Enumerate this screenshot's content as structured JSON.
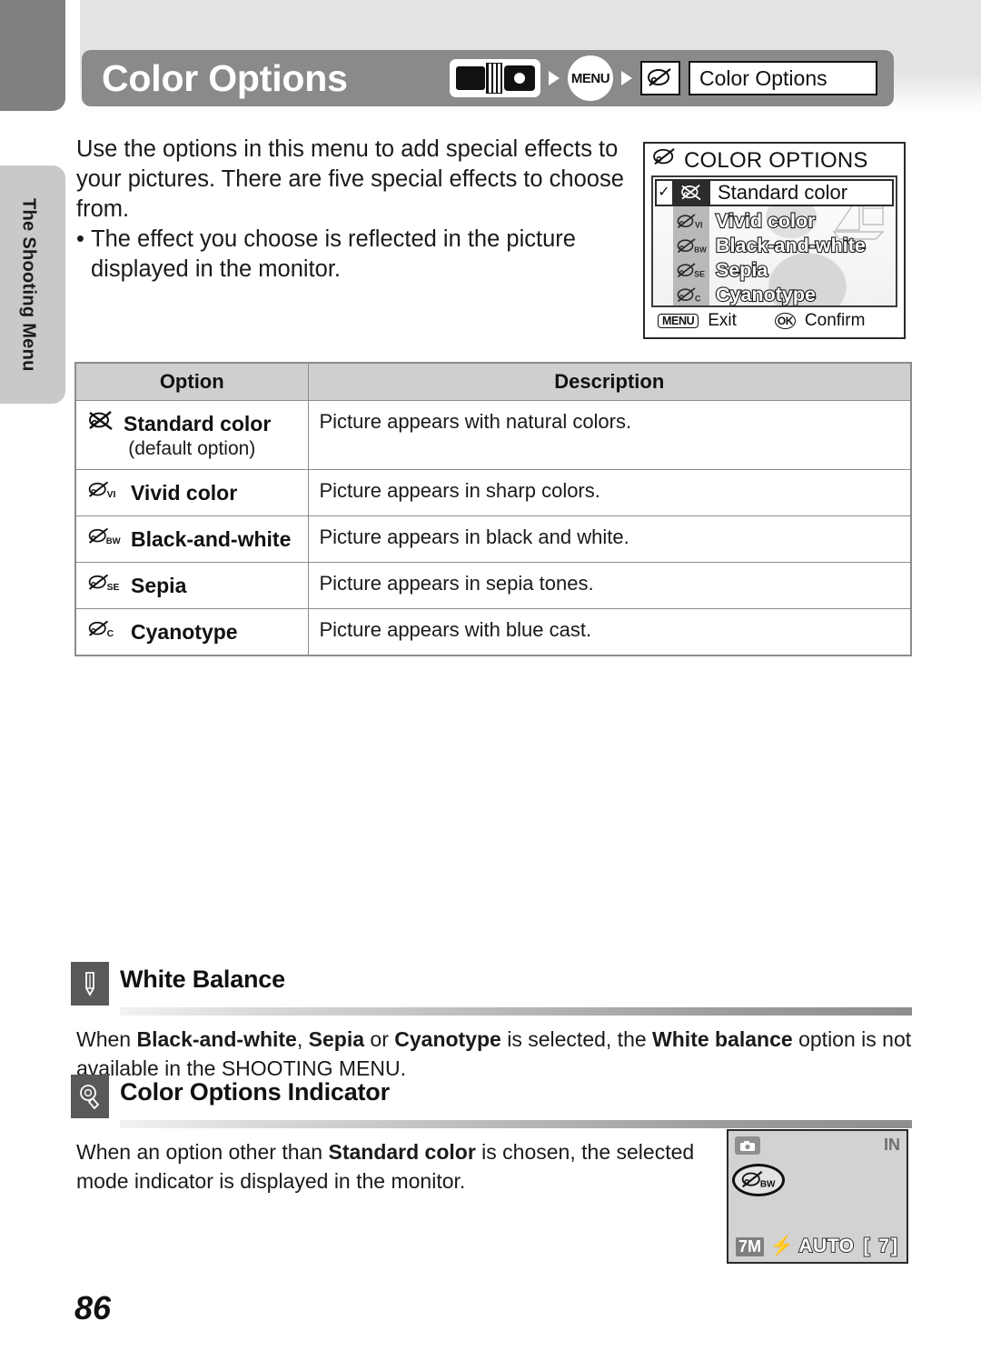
{
  "sidebar": {
    "tab_label": "The Shooting Menu"
  },
  "header": {
    "title": "Color Options",
    "breadcrumb": {
      "mode_icon": "camera-shooting-mode-icon",
      "menu_label": "MENU",
      "palette_icon": "color-options-palette-icon",
      "crumb_label": "Color Options"
    }
  },
  "intro": {
    "paragraph": "Use the options in this menu to add special effects to your pictures. There are five special effects to choose from.",
    "bullet_dot": "•",
    "bullet": "The effect you choose is reflected in the picture displayed in the monitor."
  },
  "lcd": {
    "title": "COLOR OPTIONS",
    "title_icon": "palette-icon",
    "check_glyph": "✓",
    "selected": "Standard color",
    "options": [
      {
        "icon_sub": "VI",
        "label": "Vivid color"
      },
      {
        "icon_sub": "BW",
        "label": "Black-and-white"
      },
      {
        "icon_sub": "SE",
        "label": "Sepia"
      },
      {
        "icon_sub": "C",
        "label": "Cyanotype"
      }
    ],
    "footer": {
      "menu_key": "MENU",
      "menu_action": "Exit",
      "ok_key": "OK",
      "ok_action": "Confirm"
    }
  },
  "table": {
    "headers": [
      "Option",
      "Description"
    ],
    "rows": [
      {
        "icon_sub": "",
        "icon_kind": "crossed",
        "option": "Standard color",
        "option_sub": "(default option)",
        "description": "Picture appears with natural colors."
      },
      {
        "icon_sub": "VI",
        "icon_kind": "palette",
        "option": "Vivid color",
        "option_sub": "",
        "description": "Picture appears in sharp colors."
      },
      {
        "icon_sub": "BW",
        "icon_kind": "palette",
        "option": "Black-and-white",
        "option_sub": "",
        "description": "Picture appears in black and white."
      },
      {
        "icon_sub": "SE",
        "icon_kind": "palette",
        "option": "Sepia",
        "option_sub": "",
        "description": "Picture appears in sepia tones."
      },
      {
        "icon_sub": "C",
        "icon_kind": "palette",
        "option": "Cyanotype",
        "option_sub": "",
        "description": "Picture appears with blue cast."
      }
    ]
  },
  "white_balance": {
    "icon": "pencil-note-icon",
    "title": "White Balance",
    "body_1": "When ",
    "bold_1": "Black-and-white",
    "body_2": ", ",
    "bold_2": "Sepia",
    "body_3": " or ",
    "bold_3": "Cyanotype",
    "body_4": " is selected, the ",
    "bold_4": "White balance",
    "body_5": " option is not available in the SHOOTING MENU."
  },
  "color_indicator": {
    "icon": "lightbulb-tip-icon",
    "title": "Color Options Indicator",
    "body_1": "When an option other than ",
    "bold_1": "Standard color",
    "body_2": " is chosen, the selected mode indicator is displayed in the monitor."
  },
  "monitor": {
    "mode_icon": "camera-icon",
    "memory_icon": "IN",
    "indicator_sub": "BW",
    "image_size": "7M",
    "flash_glyph": "⚡",
    "flash_mode": "AUTO",
    "shots_remaining": "[ 7]"
  },
  "footer": {
    "page_number": "86"
  },
  "colors": {
    "header_bar": "#8a8a8a",
    "tab_dark": "#808080",
    "tab_light": "#c9c9c9",
    "table_header": "#cfcfcf",
    "rule": "#8c8c8c"
  }
}
